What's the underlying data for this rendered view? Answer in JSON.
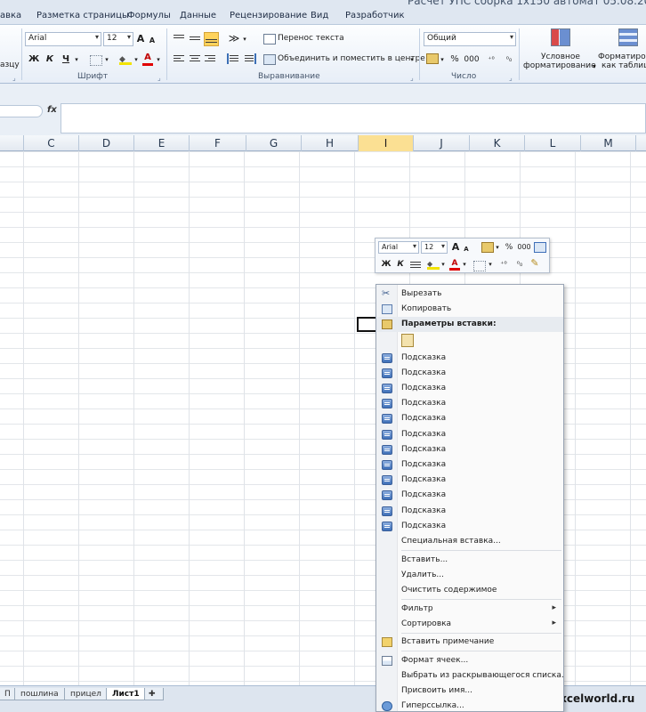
{
  "window": {
    "title": "Расчет УПС сборка 1x150 автомат 05.08.20 - M"
  },
  "menu_tabs": [
    "авка",
    "Разметка страницы",
    "Формулы",
    "Данные",
    "Рецензирование",
    "Вид",
    "Разработчик"
  ],
  "ribbon": {
    "left_partial_label": "азцу",
    "font": {
      "name": "Arial",
      "size": "12",
      "bold": "Ж",
      "italic": "К",
      "underline": "Ч",
      "font_color_letter": "А",
      "grow": "A",
      "shrink": "A",
      "group_label": "Шрифт"
    },
    "alignment": {
      "wrap_text": "Перенос текста",
      "merge_center": "Объединить и поместить в центре",
      "group_label": "Выравнивание"
    },
    "number": {
      "format": "Общий",
      "percent": "%",
      "thousands": "000",
      "group_label": "Число"
    },
    "styles": {
      "conditional_line1": "Условное",
      "conditional_line2": "форматирование",
      "table_line1": "Форматиров",
      "table_line2": "как таблиц"
    }
  },
  "formula_bar": {
    "fx_label": "fx",
    "value": ""
  },
  "columns": [
    "C",
    "D",
    "E",
    "F",
    "G",
    "H",
    "I",
    "J",
    "K",
    "L",
    "M"
  ],
  "selected_column": "I",
  "colors": {
    "selected_column": "#fbe093",
    "ribbon_highlight": "#ffd35c",
    "accent": "#3e6fb8"
  },
  "mini_toolbar": {
    "font": "Arial",
    "size": "12",
    "bold": "Ж",
    "italic": "К",
    "font_color_letter": "А",
    "percent": "%",
    "thousands": "000",
    "grow": "A",
    "shrink": "A"
  },
  "context_menu": {
    "cut": "Вырезать",
    "copy": "Копировать",
    "paste_options": "Параметры вставки:",
    "tips": [
      "Подсказка",
      "Подсказка",
      "Подсказка",
      "Подсказка",
      "Подсказка",
      "Подсказка",
      "Подсказка",
      "Подсказка",
      "Подсказка",
      "Подсказка",
      "Подсказка",
      "Подсказка"
    ],
    "paste_special": "Специальная вставка...",
    "insert": "Вставить...",
    "delete": "Удалить...",
    "clear": "Очистить содержимое",
    "filter": "Фильтр",
    "sort": "Сортировка",
    "insert_comment": "Вставить примечание",
    "format_cells": "Формат ячеек...",
    "pick_from_list": "Выбрать из раскрывающегося списка...",
    "define_name": "Присвоить имя...",
    "hyperlink": "Гиперссылка..."
  },
  "sheet_tabs": [
    "П",
    "пошлина",
    "прицел",
    "Лист1"
  ],
  "active_sheet": "Лист1",
  "watermark": "www.excelworld.ru"
}
